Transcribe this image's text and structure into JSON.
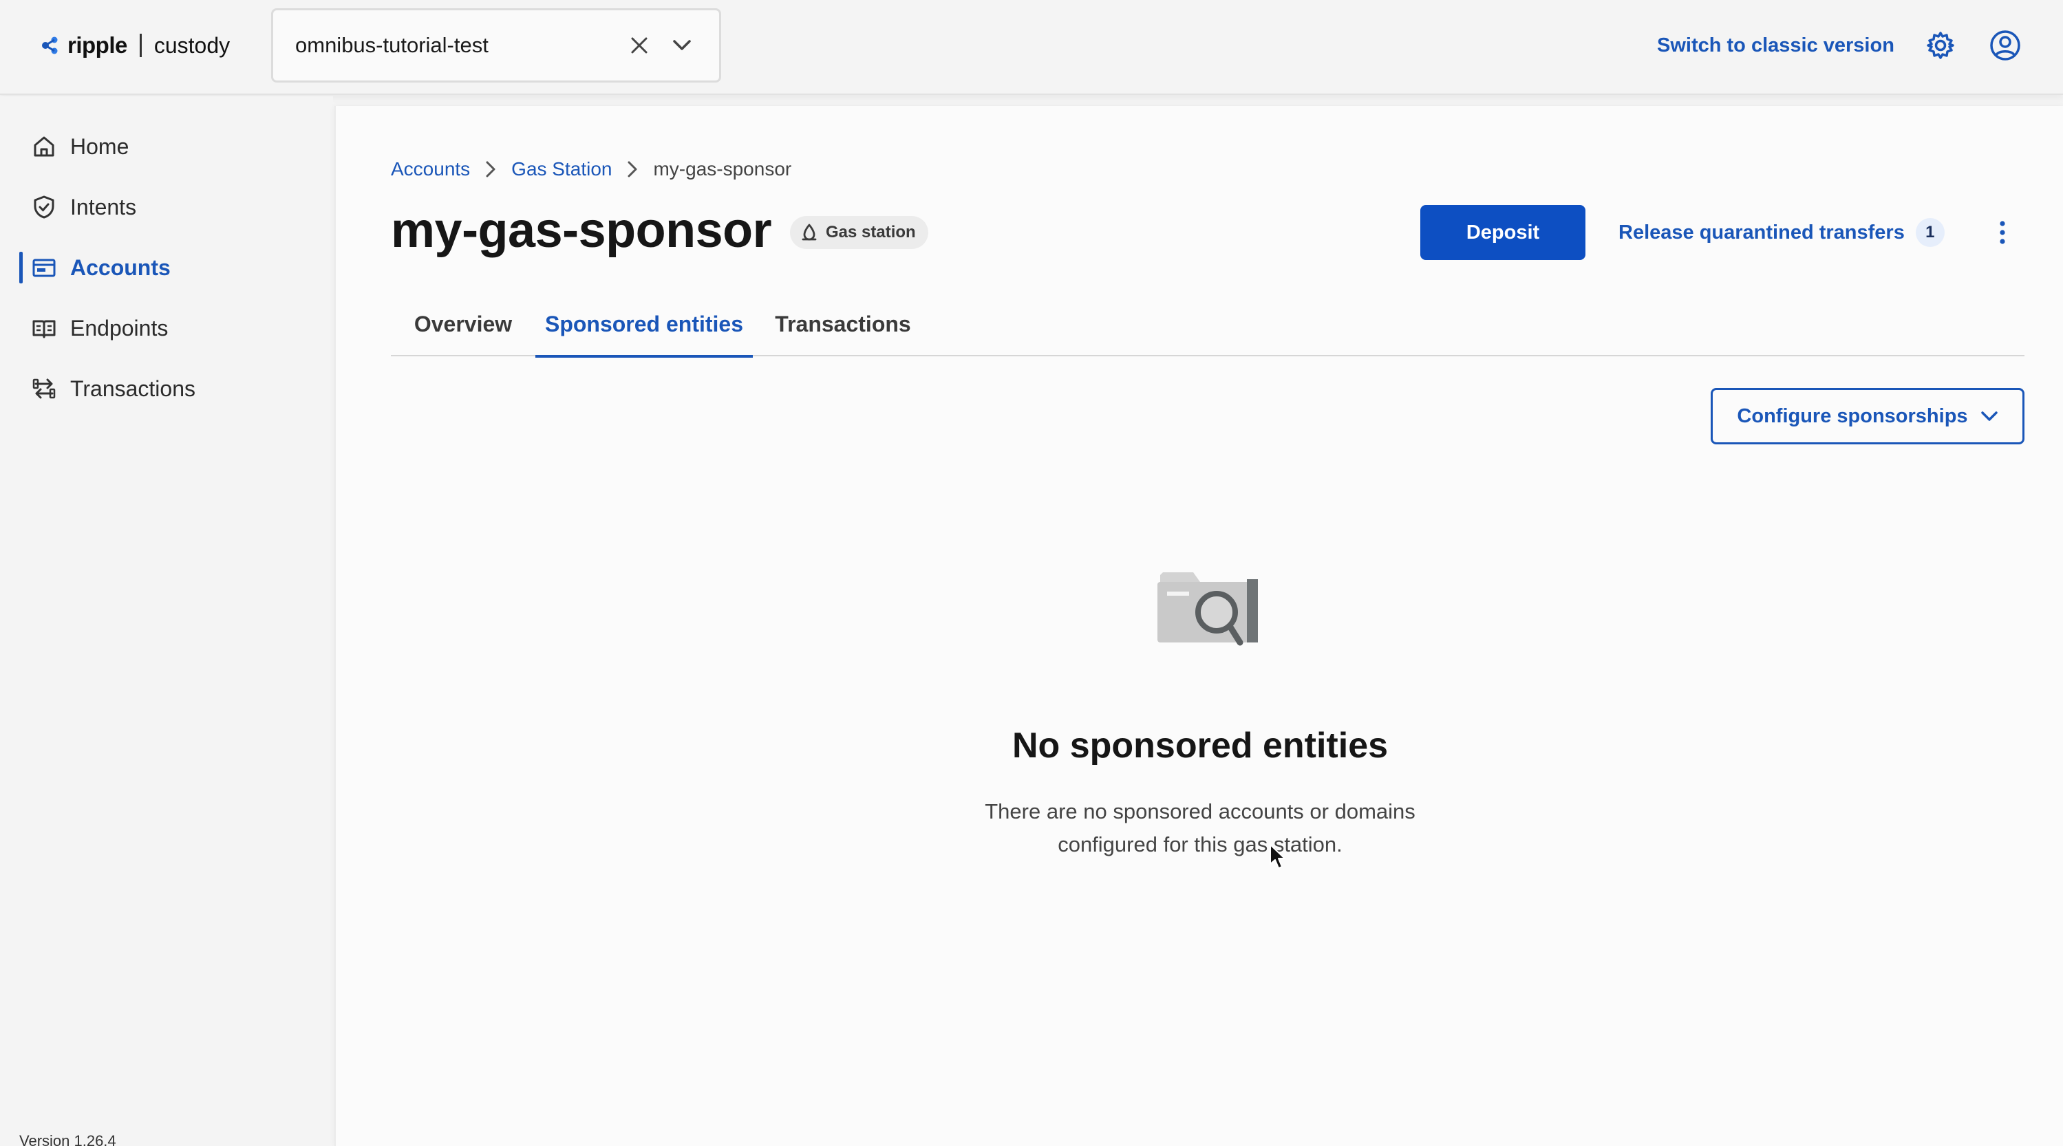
{
  "header": {
    "logo": {
      "brand": "ripple",
      "product": "custody"
    },
    "workspace": {
      "value": "omnibus-tutorial-test"
    },
    "switch_link": "Switch to classic version",
    "icons": {
      "settings": "gear-icon",
      "profile": "user-circle-icon",
      "clear": "close-icon",
      "expand": "chevron-down-icon"
    }
  },
  "sidebar": {
    "items": [
      {
        "label": "Home",
        "icon": "home-icon",
        "active": false
      },
      {
        "label": "Intents",
        "icon": "shield-check-icon",
        "active": false
      },
      {
        "label": "Accounts",
        "icon": "wallet-icon",
        "active": true
      },
      {
        "label": "Endpoints",
        "icon": "book-icon",
        "active": false
      },
      {
        "label": "Transactions",
        "icon": "transfer-icon",
        "active": false
      }
    ],
    "version": "Version 1.26.4"
  },
  "breadcrumb": {
    "items": [
      {
        "label": "Accounts"
      },
      {
        "label": "Gas Station"
      },
      {
        "label": "my-gas-sponsor"
      }
    ]
  },
  "page": {
    "title": "my-gas-sponsor",
    "badge": "Gas station",
    "deposit_label": "Deposit",
    "release_label": "Release quarantined transfers",
    "release_count": "1"
  },
  "tabs": [
    {
      "label": "Overview",
      "active": false
    },
    {
      "label": "Sponsored entities",
      "active": true
    },
    {
      "label": "Transactions",
      "active": false
    }
  ],
  "configure_label": "Configure sponsorships",
  "empty_state": {
    "title": "No sponsored entities",
    "line1": "There are no sponsored accounts or domains",
    "line2": "configured for this gas station."
  },
  "colors": {
    "accent": "#1a56b8",
    "primary_button": "#0d4fc2",
    "background": "#f4f4f4",
    "panel": "#fbfbfb"
  }
}
